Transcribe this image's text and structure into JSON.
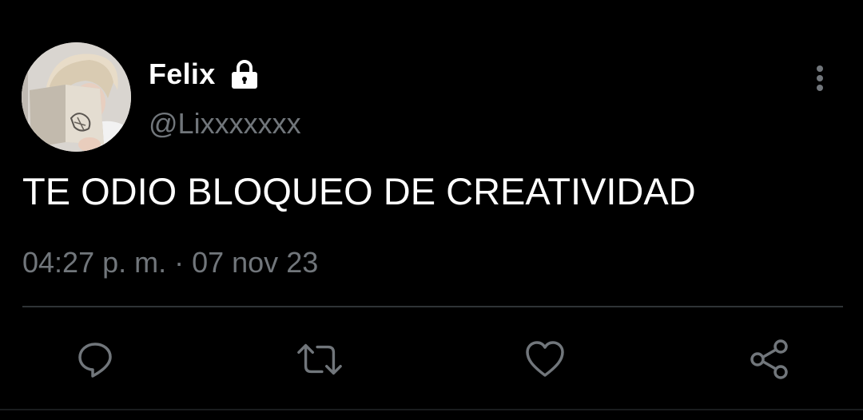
{
  "author": {
    "display_name": "Felix",
    "handle": "@Lixxxxxxx",
    "protected_icon": "lock-icon",
    "avatar": "profile-photo"
  },
  "tweet": {
    "text": "TE ODIO BLOQUEO DE CREATIVIDAD",
    "timestamp": "04:27 p. m. · 07 nov 23"
  },
  "menu": {
    "icon": "more-vertical-icon"
  },
  "actions": [
    {
      "name": "reply",
      "icon": "comment-icon"
    },
    {
      "name": "retweet",
      "icon": "retweet-icon"
    },
    {
      "name": "like",
      "icon": "heart-icon"
    },
    {
      "name": "share",
      "icon": "share-icon"
    }
  ],
  "colors": {
    "background": "#000000",
    "text_primary": "#ffffff",
    "text_secondary": "#71767b",
    "divider": "#2f3336"
  }
}
